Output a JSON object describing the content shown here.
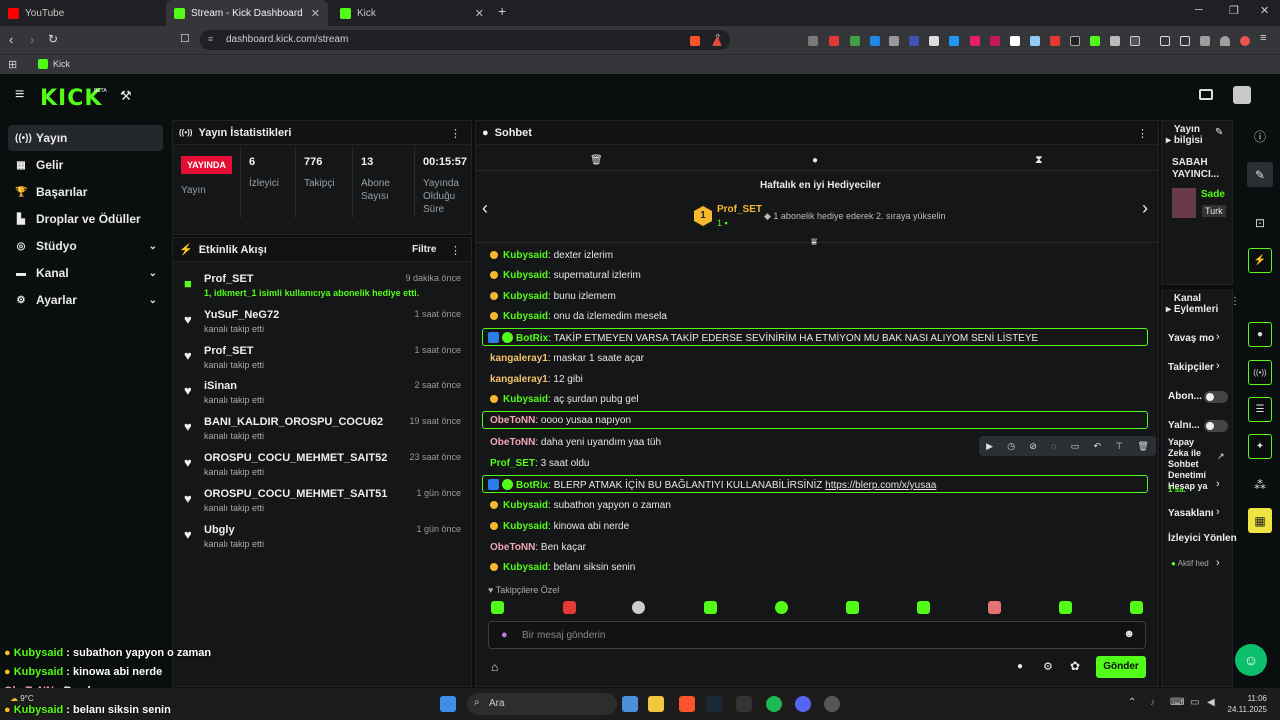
{
  "browser": {
    "tabs": [
      {
        "label": "YouTube"
      },
      {
        "label": "Stream - Kick Dashboard"
      },
      {
        "label": "Kick"
      }
    ],
    "url": "dashboard.kick.com/stream",
    "bookmark": "Kick"
  },
  "header": {
    "logo": "KICK",
    "beta": "BETA"
  },
  "nav": [
    {
      "label": "Yayın",
      "icon": "broadcast-icon"
    },
    {
      "label": "Gelir",
      "icon": "revenue-icon"
    },
    {
      "label": "Başarılar",
      "icon": "trophy-icon"
    },
    {
      "label": "Droplar ve Ödüller",
      "icon": "drops-icon"
    },
    {
      "label": "Stüdyo",
      "icon": "studio-icon"
    },
    {
      "label": "Kanal",
      "icon": "channel-icon"
    },
    {
      "label": "Ayarlar",
      "icon": "gear-icon"
    }
  ],
  "stats": {
    "title": "Yayın İstatistikleri",
    "live_badge": "YAYINDA",
    "live_label": "Yayın",
    "viewers": "6",
    "viewers_label": "İzleyici",
    "followers": "776",
    "followers_label": "Takipçi",
    "subs": "13",
    "subs_label": "Abone Sayısı",
    "duration": "00:15:57",
    "duration_label": "Yayında Olduğu Süre"
  },
  "activity": {
    "title": "Etkinlik Akışı",
    "filter": "Filtre",
    "items": [
      {
        "name": "Prof_SET",
        "sub": "1, idkmert_1 isimli kullanıcıya abonelik hediye etti.",
        "time": "9 dakika önce",
        "icon": "gift-icon"
      },
      {
        "name": "YuSuF_NeG72",
        "sub": "kanalı takip etti",
        "time": "1 saat önce",
        "icon": "heart-icon"
      },
      {
        "name": "Prof_SET",
        "sub": "kanalı takip etti",
        "time": "1 saat önce",
        "icon": "heart-icon"
      },
      {
        "name": "iSinan",
        "sub": "kanalı takip etti",
        "time": "2 saat önce",
        "icon": "heart-icon"
      },
      {
        "name": "BANI_KALDIR_OROSPU_COCU62",
        "sub": "kanalı takip etti",
        "time": "19 saat önce",
        "icon": "heart-icon"
      },
      {
        "name": "OROSPU_COCU_MEHMET_SAIT52",
        "sub": "kanalı takip etti",
        "time": "23 saat önce",
        "icon": "heart-icon"
      },
      {
        "name": "OROSPU_COCU_MEHMET_SAIT51",
        "sub": "kanalı takip etti",
        "time": "1 gün önce",
        "icon": "heart-icon"
      },
      {
        "name": "Ubgly",
        "sub": "kanalı takip etti",
        "time": "1 gün önce",
        "icon": "heart-icon"
      }
    ]
  },
  "chat": {
    "title": "Sohbet",
    "gifters_title": "Haftalık en iyi Hediyeciler",
    "top_gifter": "Prof_SET",
    "top_rank": "1",
    "top_count": "1",
    "promo": "1 abonelik hediye ederek 2. sıraya yükselin",
    "messages": [
      {
        "user": "Kubysaid",
        "text": ": dexter izlerim"
      },
      {
        "user": "Kubysaid",
        "text": ": supernatural izlerim"
      },
      {
        "user": "Kubysaid",
        "text": ": bunu izlemem"
      },
      {
        "user": "Kubysaid",
        "text": ": onu da izlemedim mesela"
      },
      {
        "user": "BotRix",
        "text": ": TAKİP ETMEYEN VARSA TAKİP EDERSE SEVİNİRİM HA ETMİYON MU BAK NASI ALIYOM SENİ LİSTEYE"
      },
      {
        "user": "kangaleray1",
        "text": ": maskar 1 saate açar"
      },
      {
        "user": "kangaleray1",
        "text": ": 12 gibi"
      },
      {
        "user": "Kubysaid",
        "text": ": aç şurdan pubg gel"
      },
      {
        "user": "ObeToNN",
        "text": ": oooo yusaa napıyon"
      },
      {
        "user": "ObeToNN",
        "text": ": daha yeni uyandım yaa tüh"
      },
      {
        "user": "Prof_SET",
        "text": ": 3 saat oldu"
      },
      {
        "user": "BotRix",
        "text": ": BLERP ATMAK İÇİN BU BAĞLANTIYI KULLANABİLİRSİNİZ ",
        "link": "https://blerp.com/x/yusaa"
      },
      {
        "user": "Kubysaid",
        "text": ": subathon yapyon o zaman"
      },
      {
        "user": "Kubysaid",
        "text": ": kinowa abi nerde"
      },
      {
        "user": "ObeToNN",
        "text": ": Ben kaçar"
      },
      {
        "user": "Kubysaid",
        "text": ": belanı siksin senin"
      }
    ],
    "followers_only": "Takipçilere Özel",
    "placeholder": "Bir mesaj gönderin",
    "send": "Gönder"
  },
  "right": {
    "info_title": "Yayın bilgisi",
    "stream_title": "SABAH YAYINCI...",
    "category": "Sade",
    "lang": "Turk",
    "actions_title": "Kanal Eylemleri",
    "actions": [
      "Yavaş mo",
      "Takipçiler",
      "Abon...",
      "Yalnı...",
      "Yapay Zeka ile Sohbet Denetimi Hesap ya",
      "Yasaklanı",
      "İzleyici Yönlen"
    ],
    "ai_count": "1 sa.",
    "active": "Aktif hed"
  },
  "overlay": [
    {
      "user": "Kubysaid",
      "text": " : subathon yapyon o zaman"
    },
    {
      "user": "Kubysaid",
      "text": " : kinowa abi nerde"
    },
    {
      "user": "ObeToNN",
      "text": " : Ben kaçar"
    },
    {
      "user": "Kubysaid",
      "text": " : belanı siksin senin"
    }
  ],
  "taskbar": {
    "search": "Ara",
    "weather": "9°C",
    "time": "11:06",
    "date": "24.11.2025"
  }
}
